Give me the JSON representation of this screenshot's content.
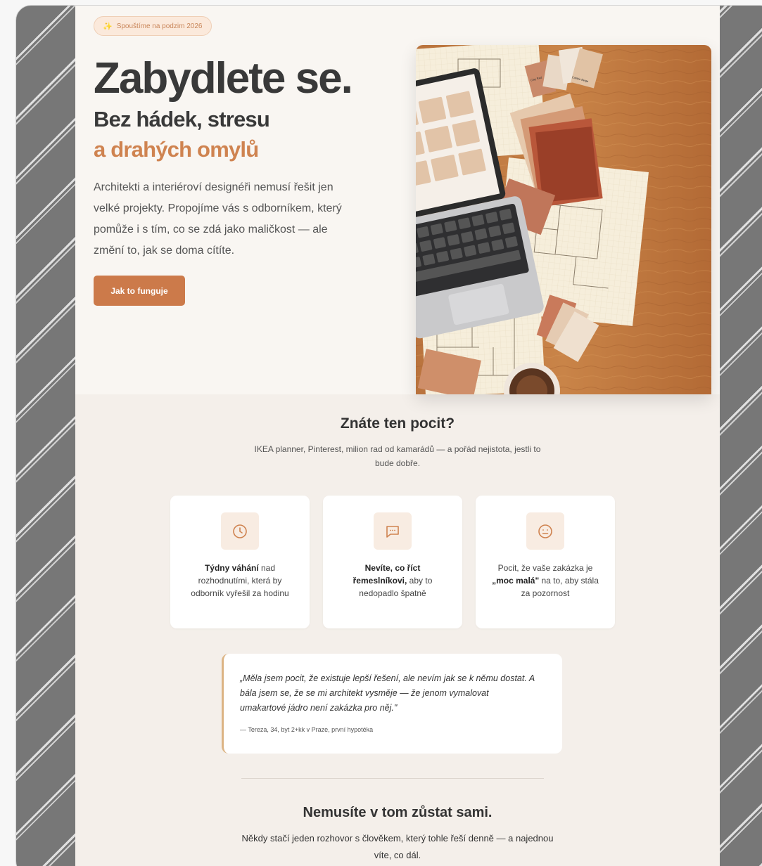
{
  "hero": {
    "badge": "Spouštíme na podzim 2026",
    "title": "Zabydlete se.",
    "subtitle_line1": "Bez hádek, stresu",
    "subtitle_line2": "a drahých omylů",
    "lead": "Architekti a interiéroví designéři nemusí řešit jen velké projekty. Propojíme vás s odborníkem, který pomůže i s tím, co se zdá jako maličkost — ale změní to, jak se doma cítíte.",
    "cta_label": "Jak to funguje"
  },
  "pain": {
    "title": "Znáte ten pocit?",
    "subtitle": "IKEA planner, Pinterest, milion rad od kamarádů — a pořád nejistota, jestli to bude dobře.",
    "cards": [
      {
        "icon": "clock-icon",
        "bold": "Týdny váhání",
        "text": " nad rozhodnutími, která by odborník vyřešil za hodinu"
      },
      {
        "icon": "message-icon",
        "bold": "Nevíte, co říct řemeslníkovi,",
        "text": " aby to nedopadlo špatně"
      },
      {
        "icon": "neutral-face-icon",
        "pre": "Pocit, že vaše zakázka je ",
        "bold": "„moc malá\"",
        "text": " na to, aby stála za pozornost"
      }
    ]
  },
  "quote": {
    "text": "„Měla jsem pocit, že existuje lepší řešení, ale nevím jak se k němu dostat. A bála jsem se, že se mi architekt vysměje — že jenom vymalovat umakartové jádro není zakázka pro něj.\"",
    "author": "— Tereza, 34, byt 2+kk v Praze, první hypotéka"
  },
  "together": {
    "title": "Nemusíte v tom zůstat sami.",
    "subtitle": "Někdy stačí jeden rozhovor s člověkem, který tohle řeší denně — a najednou víte, co dál."
  },
  "image_labels": {
    "swatch1": "Clay Red",
    "swatch2": "Dune Beige",
    "swatch3": "Cobble Beige"
  },
  "colors": {
    "accent": "#cc7a4a",
    "accent_text": "#cf8350",
    "hero_bg": "#f9f6f2",
    "section_bg": "#f4efea"
  }
}
